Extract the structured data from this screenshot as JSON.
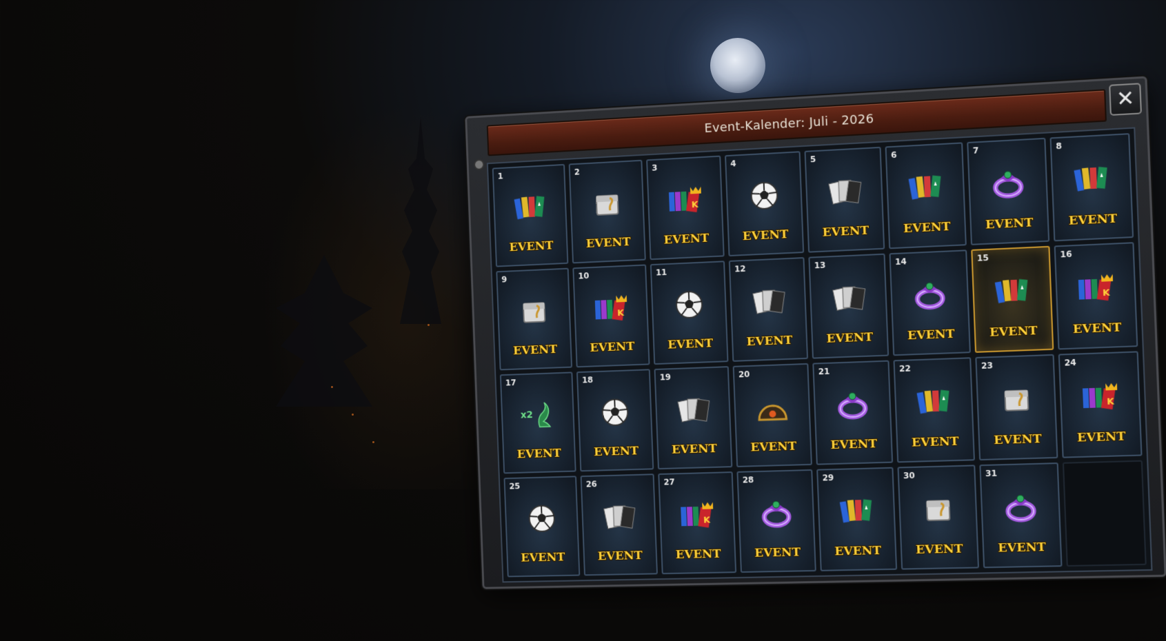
{
  "window": {
    "title": "Event-Kalender: Juli - 2026",
    "close_label": "✕"
  },
  "days": [
    {
      "n": "1",
      "label": "EVENT",
      "icon": "tickets-icon"
    },
    {
      "n": "2",
      "label": "EVENT",
      "icon": "chest-icon"
    },
    {
      "n": "3",
      "label": "EVENT",
      "icon": "king-tickets-icon"
    },
    {
      "n": "4",
      "label": "EVENT",
      "icon": "football-icon"
    },
    {
      "n": "5",
      "label": "EVENT",
      "icon": "cards-icon"
    },
    {
      "n": "6",
      "label": "EVENT",
      "icon": "tickets-icon"
    },
    {
      "n": "7",
      "label": "EVENT",
      "icon": "ring-icon"
    },
    {
      "n": "8",
      "label": "EVENT",
      "icon": "tickets-icon"
    },
    {
      "n": "9",
      "label": "EVENT",
      "icon": "chest-icon"
    },
    {
      "n": "10",
      "label": "EVENT",
      "icon": "king-tickets-icon"
    },
    {
      "n": "11",
      "label": "EVENT",
      "icon": "football-icon"
    },
    {
      "n": "12",
      "label": "EVENT",
      "icon": "cards-icon"
    },
    {
      "n": "13",
      "label": "EVENT",
      "icon": "cards-icon"
    },
    {
      "n": "14",
      "label": "EVENT",
      "icon": "ring-icon"
    },
    {
      "n": "15",
      "label": "EVENT",
      "icon": "tickets-icon",
      "today": true
    },
    {
      "n": "16",
      "label": "EVENT",
      "icon": "king-tickets-icon"
    },
    {
      "n": "17",
      "label": "EVENT",
      "icon": "dragon-x2-icon",
      "extra": "x2"
    },
    {
      "n": "18",
      "label": "EVENT",
      "icon": "football-icon"
    },
    {
      "n": "19",
      "label": "EVENT",
      "icon": "cards-icon"
    },
    {
      "n": "20",
      "label": "EVENT",
      "icon": "shield-icon"
    },
    {
      "n": "21",
      "label": "EVENT",
      "icon": "ring-icon"
    },
    {
      "n": "22",
      "label": "EVENT",
      "icon": "tickets-icon"
    },
    {
      "n": "23",
      "label": "EVENT",
      "icon": "chest-icon"
    },
    {
      "n": "24",
      "label": "EVENT",
      "icon": "king-tickets-icon"
    },
    {
      "n": "25",
      "label": "EVENT",
      "icon": "football-icon"
    },
    {
      "n": "26",
      "label": "EVENT",
      "icon": "cards-icon"
    },
    {
      "n": "27",
      "label": "EVENT",
      "icon": "king-tickets-icon"
    },
    {
      "n": "28",
      "label": "EVENT",
      "icon": "ring-icon"
    },
    {
      "n": "29",
      "label": "EVENT",
      "icon": "tickets-icon"
    },
    {
      "n": "30",
      "label": "EVENT",
      "icon": "chest-icon"
    },
    {
      "n": "31",
      "label": "EVENT",
      "icon": "ring-icon"
    }
  ],
  "colors": {
    "accent_gold": "#ffd23a",
    "title_bar": "#5a2415",
    "today_border": "#c8962e"
  }
}
